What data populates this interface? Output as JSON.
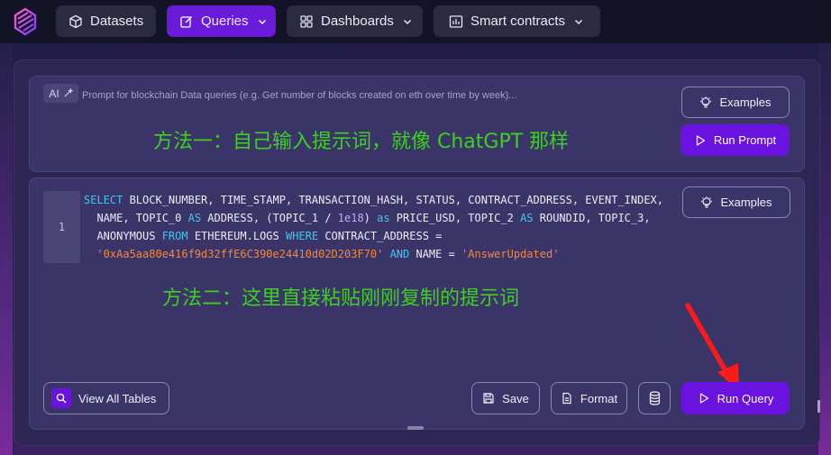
{
  "nav": {
    "datasets": "Datasets",
    "queries": "Queries",
    "dashboards": "Dashboards",
    "smart_contracts": "Smart contracts"
  },
  "prompt": {
    "ai_badge": "AI",
    "placeholder": "Prompt for blockchain Data queries (e.g. Get number of blocks created on eth over time by week)...",
    "annotation": "方法一：自己输入提示词，就像 ChatGPT 那样",
    "examples_label": "Examples",
    "run_prompt_label": "Run Prompt"
  },
  "editor": {
    "line_number": "1",
    "examples_label": "Examples",
    "annotation": "方法二：这里直接粘贴刚刚复制的提示词",
    "code": {
      "l1_select": "SELECT",
      "l1_rest": " BLOCK_NUMBER, TIME_STAMP, TRANSACTION_HASH, STATUS, CONTRACT_ADDRESS, EVENT_INDEX,",
      "l2_a": "  NAME, TOPIC_0 ",
      "l2_as1": "AS",
      "l2_b": " ADDRESS, (TOPIC_1 / ",
      "l2_num": "1e18",
      "l2_c": ") ",
      "l2_as2": "as",
      "l2_d": " PRICE_USD, TOPIC_2 ",
      "l2_as3": "AS",
      "l2_e": " ROUNDID, TOPIC_3,",
      "l3_a": "  ANONYMOUS ",
      "l3_from": "FROM",
      "l3_b": " ETHEREUM.LOGS ",
      "l3_where": "WHERE",
      "l3_c": " CONTRACT_ADDRESS =",
      "l4_indent": "  ",
      "l4_str1": "'0xAa5aa80e416f9d32ffE6C390e24410d02D203F70'",
      "l4_and": " AND",
      "l4_b": " NAME = ",
      "l4_str2": "'AnswerUpdated'"
    }
  },
  "footer": {
    "view_all_tables": "View All Tables",
    "save": "Save",
    "format": "Format",
    "run_query": "Run Query"
  },
  "colors": {
    "accent": "#6a12e0",
    "annotation_green": "#3bd11e",
    "arrow_red": "#ff1a1a"
  },
  "icons": [
    "brand-logo-icon",
    "cube-icon",
    "edit-icon",
    "grid-icon",
    "bar-chart-icon",
    "chevron-down-icon",
    "wand-icon",
    "lightbulb-icon",
    "play-icon",
    "search-icon",
    "save-icon",
    "file-icon",
    "database-icon",
    "arrow-annotation-icon"
  ]
}
